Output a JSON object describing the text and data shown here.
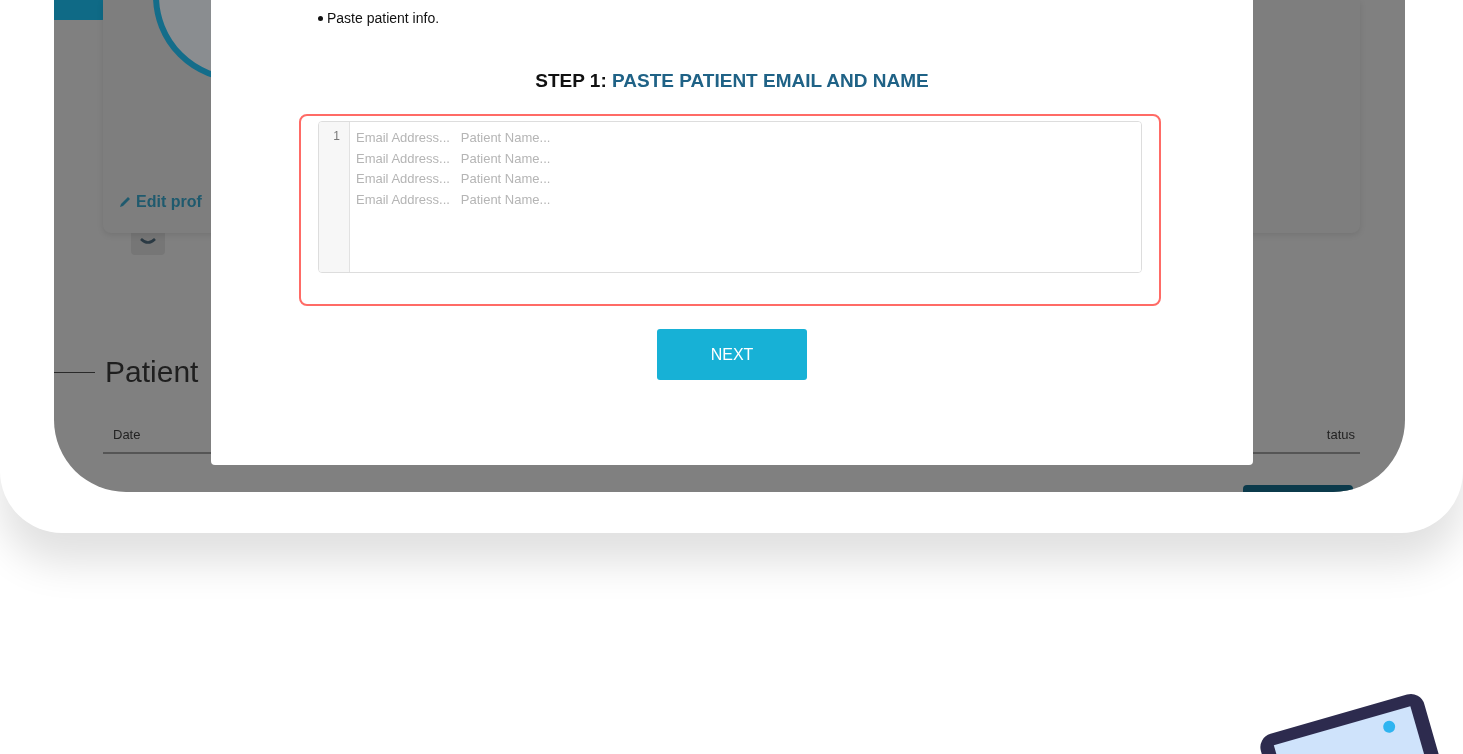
{
  "backdrop": {
    "profile_card": {
      "link": "Edit prof"
    },
    "section_title": "Patient",
    "table": {
      "columns": [
        "Date",
        "tatus"
      ]
    }
  },
  "modal": {
    "instruction": "Paste patient info.",
    "heading": {
      "step": "STEP 1:",
      "title": "PASTE PATIENT EMAIL AND NAME"
    },
    "editor": {
      "line_number": "1",
      "placeholder": "Email Address...   Patient Name...\nEmail Address...   Patient Name...\nEmail Address...   Patient Name...\nEmail Address...   Patient Name..."
    },
    "button": "NEXT"
  }
}
